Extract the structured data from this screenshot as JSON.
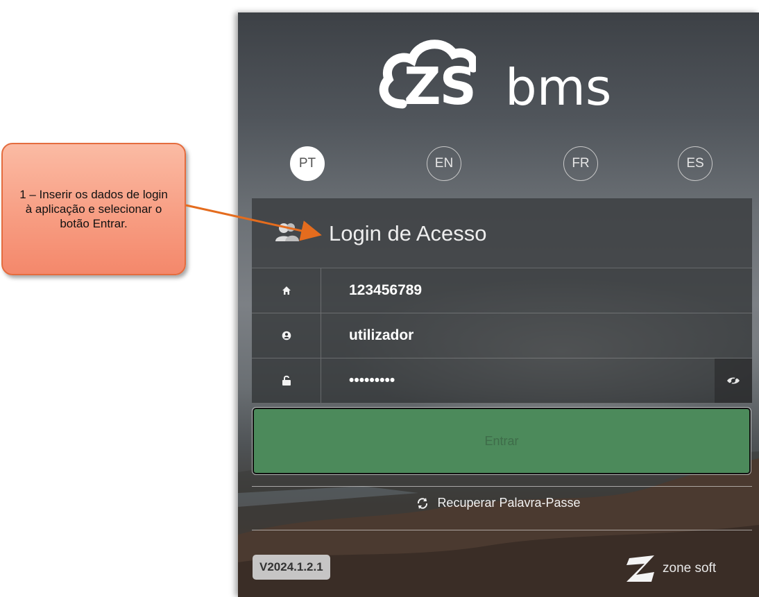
{
  "callout": {
    "text": "1 – Inserir os dados de login à aplicação e selecionar o botão Entrar."
  },
  "logo": {
    "brand": "ZS",
    "product": "bms"
  },
  "languages": [
    {
      "code": "PT",
      "active": true
    },
    {
      "code": "EN",
      "active": false
    },
    {
      "code": "FR",
      "active": false
    },
    {
      "code": "ES",
      "active": false
    }
  ],
  "form": {
    "title": "Login de Acesso",
    "title_icon": "users-icon",
    "fields": [
      {
        "icon": "home-icon",
        "value": "123456789"
      },
      {
        "icon": "user-circle-icon",
        "value": "utilizador"
      },
      {
        "icon": "unlock-icon",
        "value": "•••••••••",
        "action_icon": "eye-slash-icon"
      }
    ],
    "submit_label": "Entrar",
    "recover_label": "Recuperar Palavra-Passe",
    "recover_icon": "refresh-icon"
  },
  "footer": {
    "version": "V2024.1.2.1",
    "company": "zone soft"
  },
  "colors": {
    "submit_bg": "#4c8a5b",
    "callout_bg": "#f79b80",
    "arrow": "#e46c1e"
  }
}
